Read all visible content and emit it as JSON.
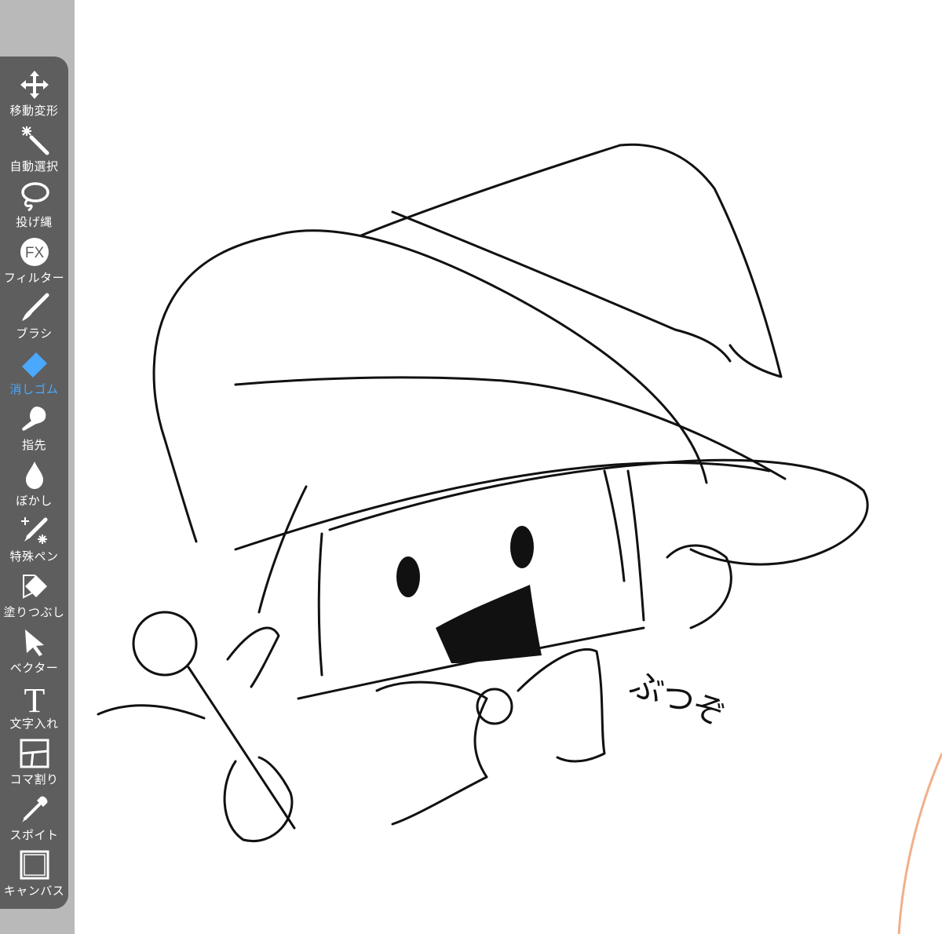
{
  "toolbar": {
    "tools": [
      {
        "label": "移動変形",
        "icon": "move-icon"
      },
      {
        "label": "自動選択",
        "icon": "magic-wand-icon"
      },
      {
        "label": "投げ縄",
        "icon": "lasso-icon"
      },
      {
        "label": "フィルター",
        "icon": "fx-icon"
      },
      {
        "label": "ブラシ",
        "icon": "brush-icon"
      },
      {
        "label": "消しゴム",
        "icon": "eraser-icon"
      },
      {
        "label": "指先",
        "icon": "finger-icon"
      },
      {
        "label": "ぼかし",
        "icon": "blur-drop-icon"
      },
      {
        "label": "特殊ペン",
        "icon": "special-pen-icon"
      },
      {
        "label": "塗りつぶし",
        "icon": "fill-bucket-icon"
      },
      {
        "label": "ベクター",
        "icon": "vector-arrow-icon"
      },
      {
        "label": "文字入れ",
        "icon": "text-icon"
      },
      {
        "label": "コマ割り",
        "icon": "frame-divide-icon"
      },
      {
        "label": "スポイト",
        "icon": "eyedropper-icon"
      },
      {
        "label": "キャンバス",
        "icon": "canvas-icon"
      }
    ],
    "active_tool": "消しゴム",
    "fx_text": "FX",
    "text_tool_glyph": "T"
  },
  "drawing": {
    "sound_effect_text": "ぶつぞ"
  },
  "colors": {
    "toolbar_bg": "#5e5e5e",
    "gutter_bg": "#b9b9b9",
    "label_color": "#ffffff",
    "active_color": "#4aa8ff",
    "stroke_color": "#111111",
    "accent_stroke": "#f0b08a"
  }
}
